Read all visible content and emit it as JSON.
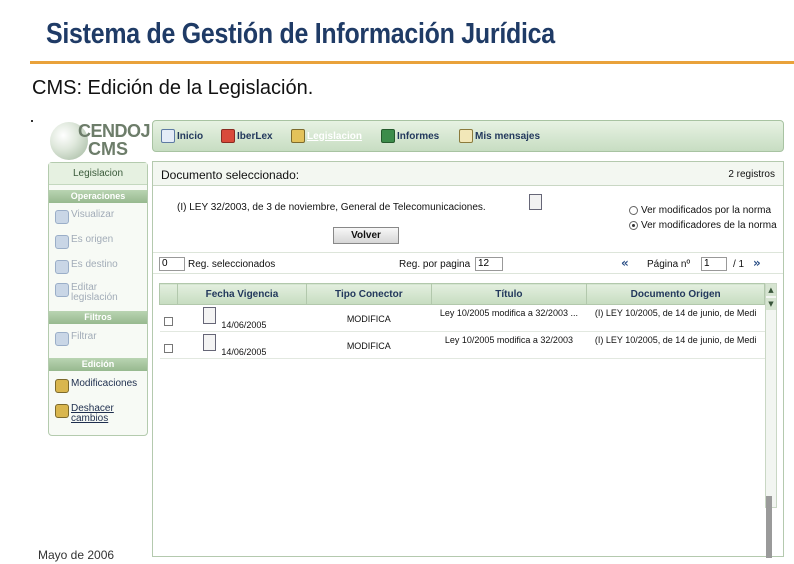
{
  "slide": {
    "title": "Sistema de Gestión de Información Jurídica",
    "subtitle": "CMS: Edición de la Legislación.",
    "footer": "Mayo de 2006"
  },
  "app": {
    "logo_line1": "CENDOJ",
    "logo_line2": "CMS",
    "nav": [
      {
        "label": "Inicio",
        "icon": "home-icon"
      },
      {
        "label": "IberLex",
        "icon": "iberlex-icon"
      },
      {
        "label": "Legislacion",
        "icon": "legislacion-icon",
        "active": true
      },
      {
        "label": "Informes",
        "icon": "chart-icon"
      },
      {
        "label": "Mis mensajes",
        "icon": "mail-icon"
      }
    ]
  },
  "sidebar": {
    "header": "Legislacion",
    "sections": {
      "operaciones": "Operaciones",
      "filtros": "Filtros",
      "edicion": "Edición"
    },
    "operaciones": [
      {
        "label": "Visualizar",
        "icon": "view-icon"
      },
      {
        "label": "Es origen",
        "icon": "origin-icon"
      },
      {
        "label": "Es destino",
        "icon": "destination-icon"
      },
      {
        "label": "Editar legislación",
        "icon": "edit-icon"
      }
    ],
    "filtros": [
      {
        "label": "Filtrar",
        "icon": "filter-icon"
      }
    ],
    "edicion": [
      {
        "label": "Modificaciones",
        "icon": "modifications-icon"
      },
      {
        "label": "Deshacer cambios",
        "icon": "undo-icon"
      }
    ]
  },
  "main": {
    "header_label": "Documento seleccionado:",
    "records_label": "2 registros",
    "document_text": "(I) LEY 32/2003, de 3 de noviembre, General de Telecomunicaciones.",
    "radio_options": [
      {
        "label": "Ver modificados por la norma",
        "checked": false
      },
      {
        "label": "Ver modificadores de la norma",
        "checked": true
      }
    ],
    "volver_label": "Volver",
    "grid_bar": {
      "selected_count": "0",
      "selected_label": "Reg. seleccionados",
      "per_page_label": "Reg. por pagina",
      "per_page_value": "12",
      "first_icon": "«",
      "page_label": "Página nº",
      "page_value": "1",
      "page_total": "/ 1",
      "last_icon": "»"
    },
    "table": {
      "columns": [
        "Fecha Vigencia",
        "Tipo Conector",
        "Título",
        "Documento Origen"
      ],
      "rows": [
        {
          "fecha": "14/06/2005",
          "tipo": "MODIFICA",
          "titulo": "Ley 10/2005 modifica a 32/2003 ...",
          "origen": "(I) LEY 10/2005, de 14 de junio, de Medi"
        },
        {
          "fecha": "14/06/2005",
          "tipo": "MODIFICA",
          "titulo": "Ley 10/2005 modifica a 32/2003",
          "origen": "(I) LEY 10/2005, de 14 de junio, de Medi"
        }
      ]
    }
  }
}
